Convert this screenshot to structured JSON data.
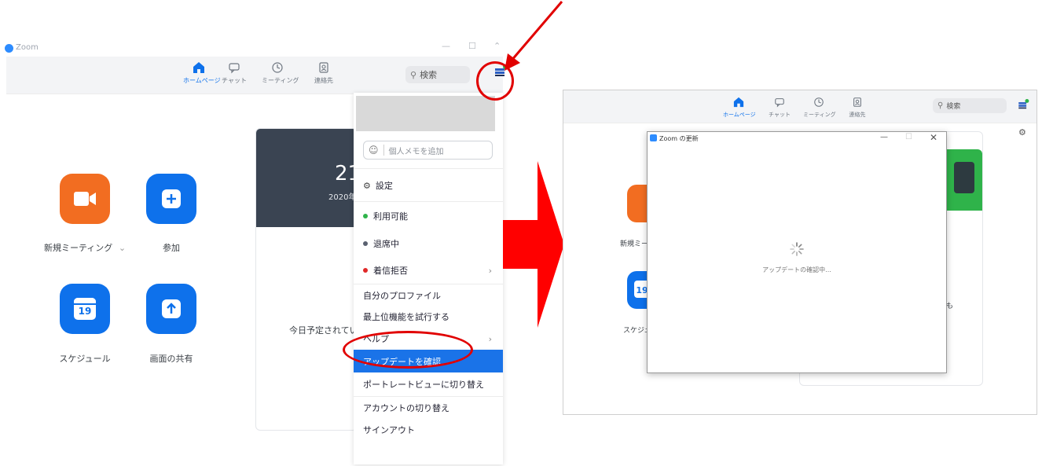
{
  "left_window": {
    "app_title": "Zoom",
    "nav_tabs": [
      {
        "label": "ホームページ",
        "icon": "home-icon",
        "active": true
      },
      {
        "label": "チャット",
        "icon": "chat-icon",
        "active": false
      },
      {
        "label": "ミーティング",
        "icon": "clock-icon",
        "active": false
      },
      {
        "label": "連絡先",
        "icon": "contacts-icon",
        "active": false
      }
    ],
    "search_label": "検索",
    "actions": [
      {
        "label": "新規ミーティング",
        "icon": "video-camera-icon",
        "color": "#f26d21",
        "has_dropdown": true
      },
      {
        "label": "参加",
        "icon": "plus-icon",
        "color": "#0e71eb"
      },
      {
        "label": "スケジュール",
        "icon": "calendar-icon",
        "color": "#0e71eb",
        "day": "19"
      },
      {
        "label": "画面の共有",
        "icon": "share-arrow-icon",
        "color": "#0e71eb"
      }
    ],
    "card": {
      "time_partial": "21",
      "date_partial": "2020年",
      "no_meetings_partial": "今日予定されているミ"
    }
  },
  "dropdown": {
    "memo_placeholder": "個人メモを追加",
    "settings_label": "設定",
    "status_items": [
      {
        "label": "利用可能",
        "dot_color": "#2fb34a"
      },
      {
        "label": "退席中",
        "dot_color": "#5a6170"
      },
      {
        "label": "着信拒否",
        "dot_color": "#e02828"
      }
    ],
    "items": [
      {
        "label": "自分のプロファイル"
      },
      {
        "label": "最上位機能を試行する"
      },
      {
        "label": "ヘルプ"
      },
      {
        "label": "アップデートを確認",
        "highlighted": true
      },
      {
        "label": "ポートレートビューに切り替え"
      },
      {
        "label": "アカウントの切り替え"
      },
      {
        "label": "サインアウト"
      }
    ]
  },
  "right_window": {
    "nav_tabs": [
      {
        "label": "ホームページ",
        "icon": "home-icon",
        "active": true
      },
      {
        "label": "チャット",
        "icon": "chat-icon",
        "active": false
      },
      {
        "label": "ミーティング",
        "icon": "clock-icon",
        "active": false
      },
      {
        "label": "連絡先",
        "icon": "contacts-icon",
        "active": false
      }
    ],
    "search_label": "検索",
    "new_meeting_partial": "新規ミーテ",
    "schedule_partial": "スケジュ",
    "schedule_day": "19",
    "card_text_partial": "も",
    "dialog": {
      "title": "Zoom の更新",
      "status": "アップデートの確認中..."
    }
  },
  "colors": {
    "accent": "#0e71eb",
    "annotation_red": "#e10000",
    "orange": "#f26d21"
  }
}
